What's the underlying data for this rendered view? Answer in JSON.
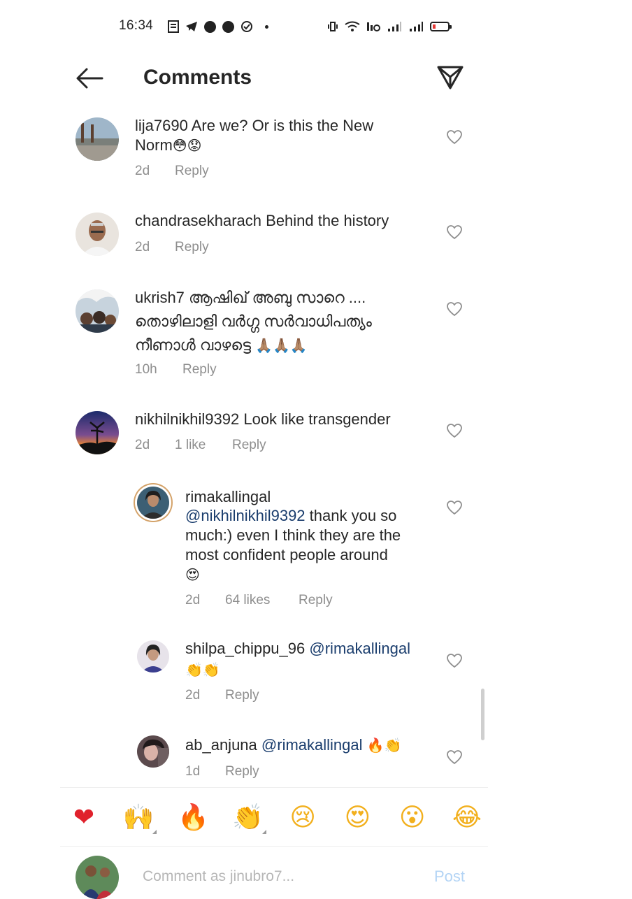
{
  "status_bar": {
    "time": "16:34"
  },
  "header": {
    "title": "Comments",
    "back_icon": "arrow-left-icon",
    "share_icon": "paper-plane-icon"
  },
  "comments": [
    {
      "username": "lija7690",
      "text_line1": "Are we? Or is this the New",
      "text_line2": "Norm",
      "emojis": "😳😟",
      "time": "2d",
      "likes": "",
      "reply_label": "Reply"
    },
    {
      "username": "chandrasekharach",
      "text_line1": "Behind the history",
      "time": "2d",
      "likes": "",
      "reply_label": "Reply"
    },
    {
      "username": "ukrish7",
      "text_line1": "ആഷിഖ് അബു സാറെ ....",
      "text_line2": "തൊഴിലാളി വർഗ്ഗ സർവാധിപത്യം",
      "text_line3": "നീണാൾ വാഴട്ടെ",
      "emojis": "🙏🏽🙏🏽🙏🏽",
      "time": "10h",
      "likes": "",
      "reply_label": "Reply"
    },
    {
      "username": "nikhilnikhil9392",
      "text_line1": "Look like transgender",
      "time": "2d",
      "likes": "1 like",
      "reply_label": "Reply"
    }
  ],
  "replies": [
    {
      "username": "rimakallingal",
      "mention": "@nikhilnikhil9392",
      "text_line1": "thank you so",
      "text_line2": "much:) even I think they are the",
      "text_line3": "most confident people around",
      "emojis": "😍",
      "time": "2d",
      "likes": "64 likes",
      "reply_label": "Reply"
    },
    {
      "username": "shilpa_chippu_96",
      "mention": "@rimakallingal",
      "emojis": "👏👏",
      "time": "2d",
      "likes": "",
      "reply_label": "Reply"
    },
    {
      "username": "ab_anjuna",
      "mention": "@rimakallingal",
      "emojis": "🔥👏",
      "time": "1d",
      "likes": "",
      "reply_label": "Reply"
    }
  ],
  "reactions": [
    "❤",
    "🙌",
    "🔥",
    "👏",
    "😢",
    "😍",
    "😮",
    "😂"
  ],
  "composer": {
    "placeholder": "Comment as jinubro7...",
    "post_label": "Post"
  },
  "colors": {
    "mention": "#1a3d6d",
    "meta": "#8e8e8e",
    "post_disabled": "#b3d4f5"
  }
}
